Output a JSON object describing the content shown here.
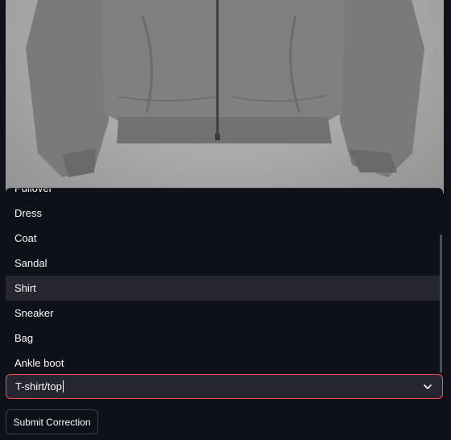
{
  "image": {
    "subject": "jacket-photo"
  },
  "dropdown": {
    "options": [
      "Pullover",
      "Dress",
      "Coat",
      "Sandal",
      "Shirt",
      "Sneaker",
      "Bag",
      "Ankle boot"
    ],
    "highlighted": "Shirt"
  },
  "select": {
    "value": "T-shirt/top",
    "border_color": "#ff4b4b"
  },
  "buttons": {
    "submit_label": "Submit Correction"
  },
  "colors": {
    "background": "#0e1117",
    "hover": "#262730",
    "accent": "#ff4b4b",
    "text": "#fafafa"
  },
  "icons": {
    "select_chevron": "chevron-down-icon"
  }
}
